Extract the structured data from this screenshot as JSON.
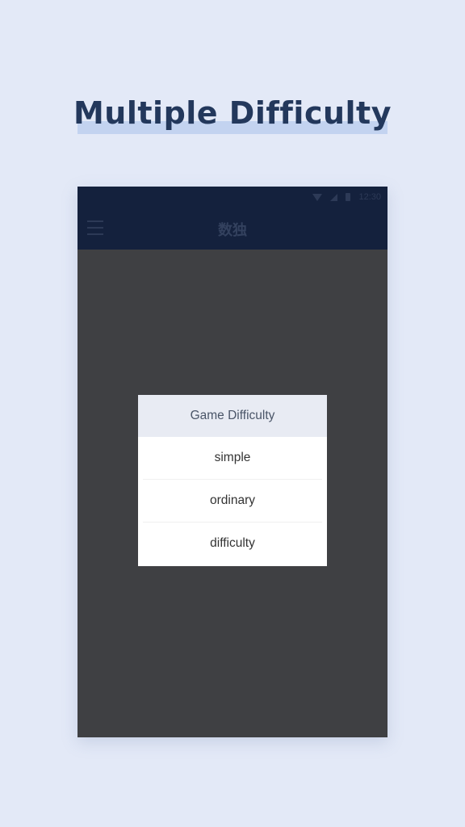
{
  "headline": "Multiple Difficulty",
  "status_bar": {
    "time": "12:30",
    "icons": [
      "wifi-icon",
      "signal-icon",
      "battery-icon"
    ]
  },
  "app_bar": {
    "title": "数独",
    "menu_icon": "menu-icon"
  },
  "dialog": {
    "title": "Game Difficulty",
    "options": [
      "simple",
      "ordinary",
      "difficulty"
    ]
  },
  "colors": {
    "page_background": "#e3e9f7",
    "headline_text": "#23385c",
    "headline_highlight": "#c3d3f0",
    "app_bar": "#14213d",
    "overlay": "#3f4043",
    "dialog_header": "#e8ebf3",
    "dialog_background": "#ffffff"
  }
}
